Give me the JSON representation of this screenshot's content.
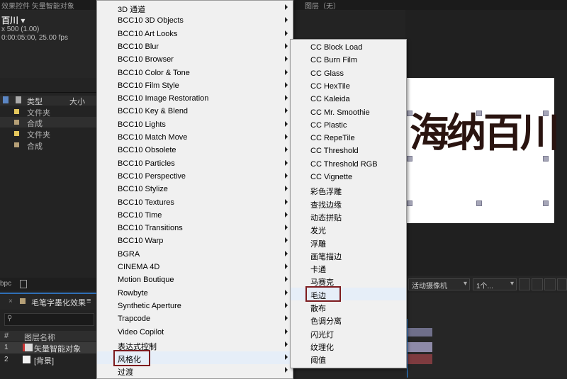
{
  "top": {
    "left_tabs": "效果控件 矢量智能对象",
    "right_tabs": "图层（无）"
  },
  "project": {
    "comp_name": "百川 ▾",
    "info_line1": "x 500 (1.00)",
    "info_line2": "0:00:05:00, 25.00 fps",
    "col_type": "类型",
    "col_size": "大小",
    "items": [
      {
        "label": "文件夹",
        "color": "#e4c75c"
      },
      {
        "label": "合成",
        "color": "#b6a077"
      },
      {
        "label": "文件夹",
        "color": "#e4c75c"
      },
      {
        "label": "合成",
        "color": "#b6a077"
      }
    ],
    "footer_bpc": "bpc"
  },
  "timeline": {
    "tab_label": "毛笔字墨化效果",
    "col_num": "#",
    "col_name": "图层名称",
    "layers": [
      {
        "num": "1",
        "name": "矢量智能对象"
      },
      {
        "num": "2",
        "name": "[背景]"
      }
    ]
  },
  "viewer": {
    "calligraphy": "海纳百川",
    "camera_label": "活动摄像机",
    "view_count": "1个..."
  },
  "menu1": {
    "items": [
      {
        "label": "3D 通道",
        "submenu": true
      },
      {
        "label": "BCC10 3D Objects",
        "submenu": true
      },
      {
        "label": "BCC10 Art Looks",
        "submenu": true
      },
      {
        "label": "BCC10 Blur",
        "submenu": true
      },
      {
        "label": "BCC10 Browser",
        "submenu": true
      },
      {
        "label": "BCC10 Color & Tone",
        "submenu": true
      },
      {
        "label": "BCC10 Film Style",
        "submenu": true
      },
      {
        "label": "BCC10 Image Restoration",
        "submenu": true
      },
      {
        "label": "BCC10 Key & Blend",
        "submenu": true
      },
      {
        "label": "BCC10 Lights",
        "submenu": true
      },
      {
        "label": "BCC10 Match Move",
        "submenu": true
      },
      {
        "label": "BCC10 Obsolete",
        "submenu": true
      },
      {
        "label": "BCC10 Particles",
        "submenu": true
      },
      {
        "label": "BCC10 Perspective",
        "submenu": true
      },
      {
        "label": "BCC10 Stylize",
        "submenu": true
      },
      {
        "label": "BCC10 Textures",
        "submenu": true
      },
      {
        "label": "BCC10 Time",
        "submenu": true
      },
      {
        "label": "BCC10 Transitions",
        "submenu": true
      },
      {
        "label": "BCC10 Warp",
        "submenu": true
      },
      {
        "label": "BGRA",
        "submenu": true
      },
      {
        "label": "CINEMA 4D",
        "submenu": true
      },
      {
        "label": "Motion Boutique",
        "submenu": true
      },
      {
        "label": "Rowbyte",
        "submenu": true
      },
      {
        "label": "Synthetic Aperture",
        "submenu": true
      },
      {
        "label": "Trapcode",
        "submenu": true
      },
      {
        "label": "Video Copilot",
        "submenu": true
      },
      {
        "label": "表达式控制",
        "submenu": true
      },
      {
        "label": "风格化",
        "submenu": true,
        "selected": true
      },
      {
        "label": "过渡",
        "submenu": true
      }
    ]
  },
  "menu2": {
    "items": [
      {
        "label": "CC Block Load"
      },
      {
        "label": "CC Burn Film"
      },
      {
        "label": "CC Glass"
      },
      {
        "label": "CC HexTile"
      },
      {
        "label": "CC Kaleida"
      },
      {
        "label": "CC Mr. Smoothie"
      },
      {
        "label": "CC Plastic"
      },
      {
        "label": "CC RepeTile"
      },
      {
        "label": "CC Threshold"
      },
      {
        "label": "CC Threshold RGB"
      },
      {
        "label": "CC Vignette"
      },
      {
        "label": "彩色浮雕"
      },
      {
        "label": "查找边缘"
      },
      {
        "label": "动态拼贴"
      },
      {
        "label": "发光"
      },
      {
        "label": "浮雕"
      },
      {
        "label": "画笔描边"
      },
      {
        "label": "卡通"
      },
      {
        "label": "马赛克"
      },
      {
        "label": "毛边",
        "selected": true
      },
      {
        "label": "散布"
      },
      {
        "label": "色调分离"
      },
      {
        "label": "闪光灯"
      },
      {
        "label": "纹理化"
      },
      {
        "label": "阈值"
      }
    ]
  },
  "colors": {
    "highlight_box": "#7d1b1f",
    "menu_bg": "#f0f0f0",
    "panel_bg": "#232323"
  }
}
